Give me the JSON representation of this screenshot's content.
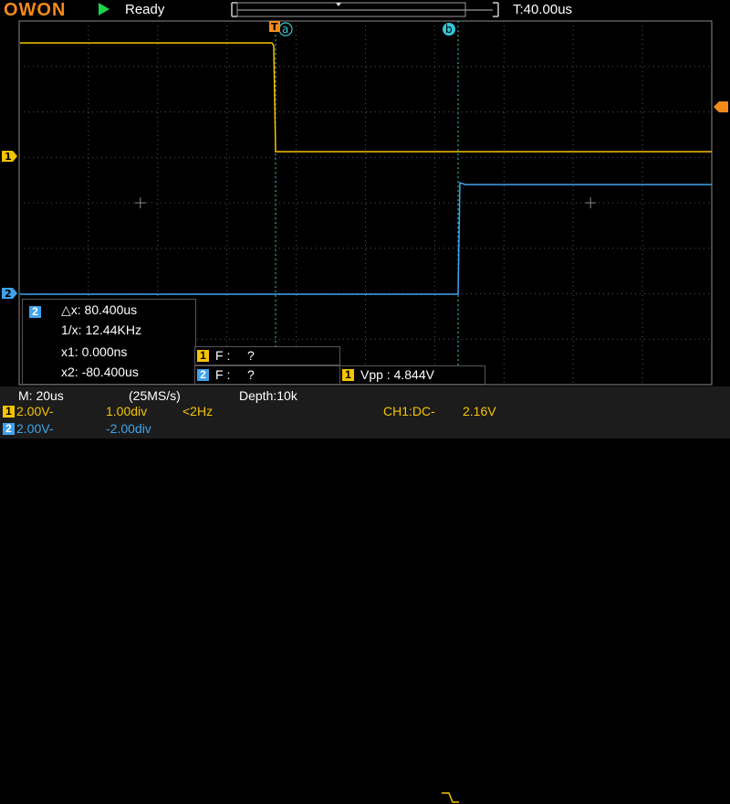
{
  "header": {
    "logo": "OWON",
    "status": "Ready",
    "timebase": "T:40.00us"
  },
  "cursors": {
    "a_label": "a",
    "b_label": "b",
    "trigger_marker": "T"
  },
  "markers": {
    "ch1": "1",
    "ch2": "2"
  },
  "cursor_panel": {
    "channel": "2",
    "delta_x": "△x: 80.400us",
    "inv_x": "1/x: 12.44KHz",
    "x1": "x1: 0.000ns",
    "x2": "x2: -80.400us"
  },
  "freq_boxes": [
    {
      "channel": "1",
      "label": "F :",
      "value": "?"
    },
    {
      "channel": "2",
      "label": "F :",
      "value": "?"
    }
  ],
  "vpp_box": {
    "channel": "1",
    "text": "Vpp : 4.844V"
  },
  "bottom": {
    "timebase": "M: 20us",
    "sample_rate": "(25MS/s)",
    "depth": "Depth:10k",
    "ch1_scale": "2.00V-",
    "ch1_offset": "1.00div",
    "ch1_freq": "<2Hz",
    "trigger": "CH1:DC-",
    "trigger_level": "2.16V",
    "ch2_scale": "2.00V-",
    "ch2_offset": "-2.00div"
  },
  "colors": {
    "ch1": "#f5c400",
    "ch2": "#3fa3ee",
    "cursor": "#35c6d6",
    "grid": "#6e6e6e",
    "logo": "#f28a1a",
    "run": "#19d64a"
  }
}
